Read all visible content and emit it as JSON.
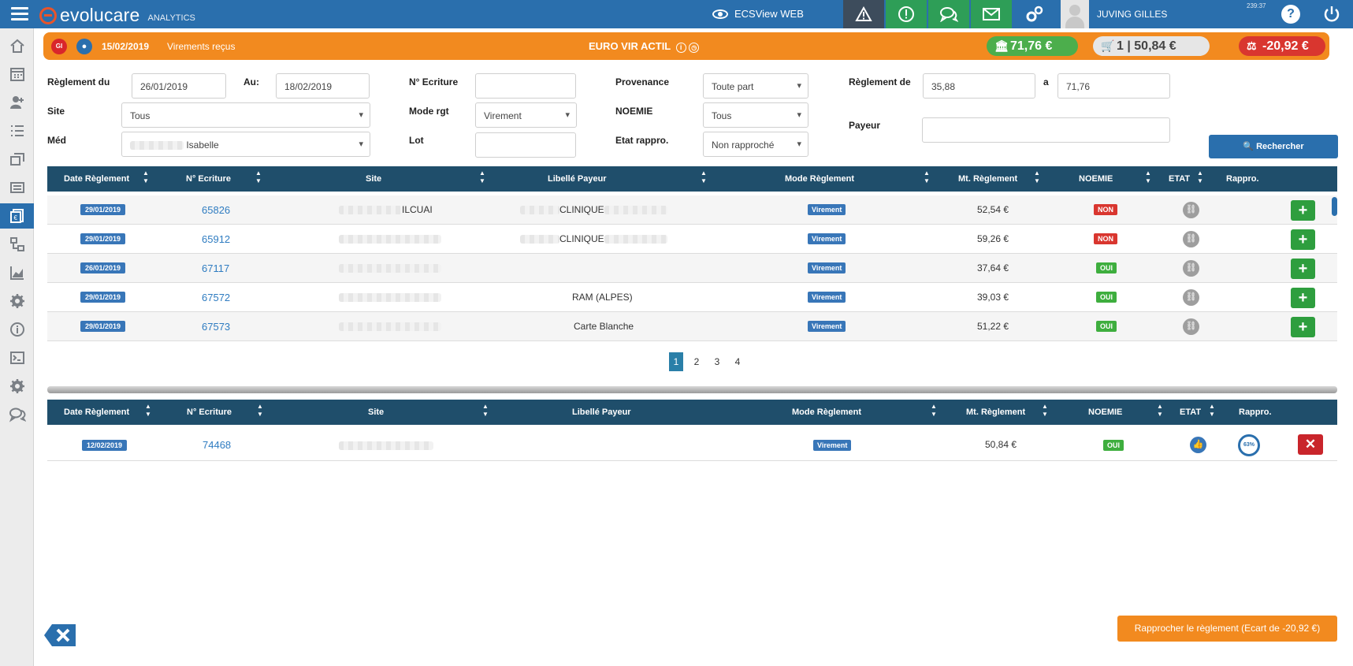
{
  "header": {
    "brand": "evolucare",
    "product": "ANALYTICS",
    "ecsview_label": "ECSView WEB",
    "user_name": "JUVING GILLES",
    "clock": "239:37",
    "help_label": "?"
  },
  "sidebar": {
    "items": [
      "home-icon",
      "calendar-icon",
      "user-add-icon",
      "list-icon",
      "windows-icon",
      "printer-icon",
      "payment-icon",
      "diagram-icon",
      "chart-icon",
      "settings-icon",
      "info-icon",
      "terminal-icon",
      "gear-icon",
      "chat-icon"
    ],
    "active_index": 6
  },
  "banner": {
    "badge": "GI",
    "date": "15/02/2019",
    "section": "Virements reçus",
    "title": "EURO VIR ACTIL",
    "amount_total": "71,76 €",
    "amount_matched": "1 | 50,84 €",
    "amount_gap": "-20,92 €",
    "colors": {
      "bar": "#f28a1f",
      "green": "#4cae4c",
      "red": "#d9362f"
    }
  },
  "filters": {
    "reglement_du": {
      "label": "Règlement du",
      "value": "26/01/2019"
    },
    "au": {
      "label": "Au:",
      "value": "18/02/2019"
    },
    "n_ecriture": {
      "label": "N° Ecriture",
      "value": ""
    },
    "provenance": {
      "label": "Provenance",
      "value": "Toute part"
    },
    "reglement_de": {
      "label": "Règlement de",
      "value": "35,88"
    },
    "a": {
      "label": "a",
      "value": "71,76"
    },
    "site": {
      "label": "Site",
      "value": "Tous"
    },
    "mode_rgt": {
      "label": "Mode rgt",
      "value": "Virement"
    },
    "noemie": {
      "label": "NOEMIE",
      "value": "Tous"
    },
    "payeur": {
      "label": "Payeur",
      "value": ""
    },
    "med": {
      "label": "Méd",
      "value": "Isabelle"
    },
    "lot": {
      "label": "Lot",
      "value": ""
    },
    "etat_rappro": {
      "label": "Etat rappro.",
      "value": "Non rapproché"
    },
    "search_button": "Rechercher"
  },
  "table1": {
    "columns": [
      "Date Règlement",
      "N° Ecriture",
      "Site",
      "Libellé Payeur",
      "Mode Règlement",
      "Mt. Règlement",
      "NOEMIE",
      "ETAT",
      "Rappro."
    ],
    "rows": [
      {
        "date": "29/01/2019",
        "ecriture": "65826",
        "site": "ILCUAI",
        "payeur": "CLINIQUE",
        "mode": "Virement",
        "montant": "52,54 €",
        "noemie": "NON"
      },
      {
        "date": "29/01/2019",
        "ecriture": "65912",
        "site": "",
        "payeur": "CLINIQUE",
        "mode": "Virement",
        "montant": "59,26 €",
        "noemie": "NON"
      },
      {
        "date": "26/01/2019",
        "ecriture": "67117",
        "site": "",
        "payeur": "",
        "mode": "Virement",
        "montant": "37,64 €",
        "noemie": "OUI"
      },
      {
        "date": "29/01/2019",
        "ecriture": "67572",
        "site": "",
        "payeur": "RAM (ALPES)",
        "mode": "Virement",
        "montant": "39,03 €",
        "noemie": "OUI"
      },
      {
        "date": "29/01/2019",
        "ecriture": "67573",
        "site": "",
        "payeur": "Carte Blanche",
        "mode": "Virement",
        "montant": "51,22 €",
        "noemie": "OUI"
      }
    ]
  },
  "pagination": {
    "pages": [
      "1",
      "2",
      "3",
      "4"
    ],
    "current": "1"
  },
  "table2": {
    "columns": [
      "Date Règlement",
      "N° Ecriture",
      "Site",
      "Libellé Payeur",
      "Mode Règlement",
      "Mt. Règlement",
      "NOEMIE",
      "ETAT",
      "Rappro."
    ],
    "rows": [
      {
        "date": "12/02/2019",
        "ecriture": "74468",
        "site": "",
        "payeur": "",
        "mode": "Virement",
        "montant": "50,84 €",
        "noemie": "OUI",
        "rappro": "63%"
      }
    ]
  },
  "footer": {
    "rapprocher_button": "Rapprocher le règlement (Ecart de -20,92 €)"
  }
}
